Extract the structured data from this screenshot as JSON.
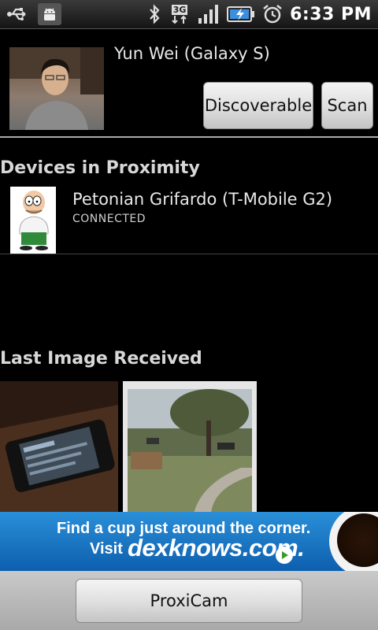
{
  "status_bar": {
    "time": "6:33 PM",
    "network": "3G",
    "icons": [
      "usb-icon",
      "android-debug-icon",
      "bluetooth-icon",
      "network-3g-icon",
      "signal-icon",
      "battery-charging-icon",
      "alarm-icon"
    ]
  },
  "profile": {
    "name": "Yun Wei (Galaxy S)",
    "discoverable_label": "Discoverable",
    "scan_label": "Scan"
  },
  "devices_section": {
    "title": "Devices in Proximity",
    "items": [
      {
        "name": "Petonian Grifardo (T-Mobile G2)",
        "status": "CONNECTED"
      }
    ]
  },
  "images_section": {
    "title": "Last Image Received"
  },
  "ad": {
    "line1": "Find a cup just around the corner.",
    "visit_label": "Visit",
    "domain": "dexknows.com."
  },
  "bottom": {
    "proxicam_label": "ProxiCam"
  },
  "colors": {
    "background": "#000000",
    "ad_blue": "#1a78c8",
    "button_gray": "#dedede"
  }
}
